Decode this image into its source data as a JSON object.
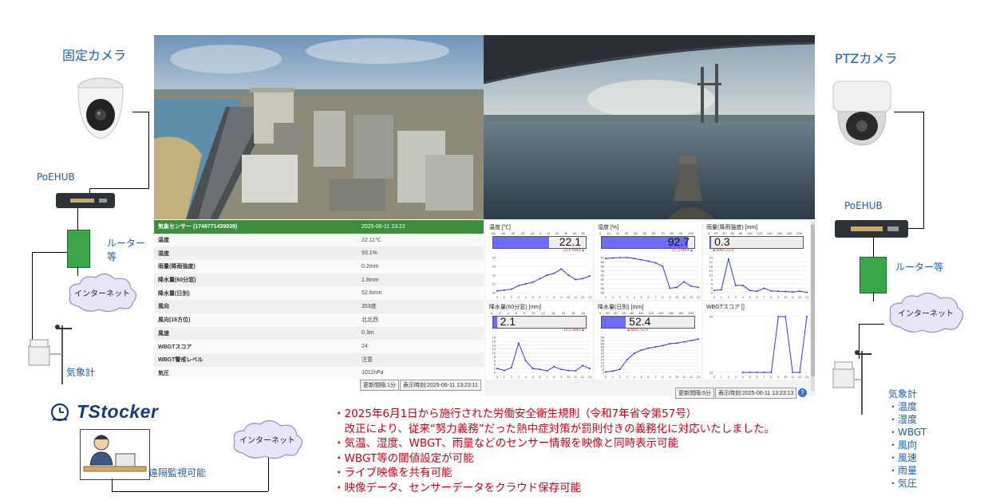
{
  "left": {
    "fixed_camera_title": "固定カメラ",
    "poe_hub_label": "PoEHUB",
    "router_label_line1": "ルーター",
    "router_label_line2": "等",
    "internet_label": "インターネット",
    "weather_meter_label": "気象計"
  },
  "right": {
    "ptz_camera_title": "PTZカメラ",
    "poe_hub_label": "PoEHUB",
    "router_label": "ルーター等",
    "internet_label": "インターネット",
    "weather_meter_label": "気象計",
    "weather_items": [
      "・温度",
      "・湿度",
      "・WBGT",
      "・風向",
      "・風速",
      "・雨量",
      "・気圧"
    ]
  },
  "bottom_left": {
    "brand": "TStocker",
    "internet_label": "インターネット",
    "remote_label": "遠隔監視可能"
  },
  "sensor_table": {
    "header_key": "気象センサー (1746771439039)",
    "header_value": "2025-06-11 13:22",
    "rows": [
      {
        "k": "温度",
        "v": "22.11℃"
      },
      {
        "k": "湿度",
        "v": "93.1%"
      },
      {
        "k": "雨量(降雨強度)",
        "v": "0.2mm"
      },
      {
        "k": "降水量(60分窓)",
        "v": "1.8mm"
      },
      {
        "k": "降水量(日別)",
        "v": "52.6mm"
      },
      {
        "k": "風向",
        "v": "353度"
      },
      {
        "k": "風向(16方位)",
        "v": "北北西"
      },
      {
        "k": "風速",
        "v": "0.3m"
      },
      {
        "k": "WBGTスコア",
        "v": "24"
      },
      {
        "k": "WBGT警戒レベル",
        "v": "注意"
      },
      {
        "k": "気圧",
        "v": "1011hPa"
      }
    ],
    "update_interval": "更新間隔:1分",
    "display_time": "表示時刻:2025-06-11 13:23:11"
  },
  "charts_footer": {
    "update_interval": "更新間隔:5分",
    "display_time": "表示時刻:2025-06-11 13:23:13",
    "help_icon": "?"
  },
  "chart_data": [
    {
      "type": "line",
      "title": "温度 [℃]",
      "gauge_value": "22.1",
      "gauge_max": "22.6 MAX▲",
      "gauge_fraction": 0.6,
      "gauge_ticks": [
        "-50",
        "-40",
        "-30",
        "-20",
        "-10",
        "0",
        "10",
        "20",
        "30",
        "40",
        "50"
      ],
      "yticks": [
        "20",
        "21",
        "22",
        "23",
        "24"
      ],
      "xticks": [
        "0",
        "1",
        "2",
        "3",
        "4",
        "5",
        "6",
        "7",
        "8",
        "9",
        "10",
        "11",
        "12",
        "13"
      ],
      "values": [
        20.2,
        20.3,
        20.4,
        20.8,
        21.0,
        21.2,
        21.6,
        22.0,
        22.2,
        22.7,
        22.0,
        21.5,
        21.6,
        21.9
      ]
    },
    {
      "type": "line",
      "title": "湿度 [%]",
      "gauge_value": "92.7",
      "gauge_max": "97.3 MAX▲",
      "gauge_fraction": 0.93,
      "gauge_ticks": [
        "0",
        "10",
        "20",
        "30",
        "40",
        "50",
        "60",
        "70",
        "80",
        "90",
        "100"
      ],
      "yticks": [
        "89",
        "90",
        "91",
        "92",
        "93",
        "94",
        "95",
        "96",
        "97"
      ],
      "xticks": [
        "0",
        "1",
        "2",
        "3",
        "4",
        "5",
        "6",
        "7",
        "8",
        "9",
        "10",
        "11",
        "12",
        "13"
      ],
      "values": [
        96.8,
        96.9,
        97.0,
        97.0,
        96.8,
        96.5,
        96.2,
        95.8,
        95.0,
        90.0,
        90.2,
        91.5,
        90.5,
        90.2
      ]
    },
    {
      "type": "line",
      "title": "雨量(降雨強度) [mm]",
      "gauge_value": "0.3",
      "gauge_max": "▲MAX 23.5",
      "gauge_fraction": 0.01,
      "gauge_ticks": [
        "0",
        "20",
        "40",
        "60",
        "80",
        "100",
        "120",
        "140",
        "160",
        "180",
        "200"
      ],
      "yticks": [
        "0",
        "3",
        "6",
        "9",
        "12",
        "15",
        "18",
        "21",
        "24"
      ],
      "xticks": [
        "0",
        "1",
        "2",
        "3",
        "4",
        "5",
        "6",
        "7",
        "8",
        "9",
        "10",
        "11",
        "12",
        "13"
      ],
      "values": [
        1.5,
        2.0,
        23.0,
        5.0,
        5.0,
        1.5,
        1.0,
        3.0,
        1.2,
        1.0,
        0.8,
        0.5,
        1.0,
        0.3
      ]
    },
    {
      "type": "line",
      "title": "降水量(60分窓) [mm]",
      "gauge_value": "2.1",
      "gauge_max": "18.5 MAX▲",
      "gauge_fraction": 0.04,
      "gauge_ticks": [
        "0",
        "2",
        "4",
        "6",
        "8",
        "10",
        "12",
        "14",
        "16",
        "18",
        "20"
      ],
      "yticks": [
        "0",
        "2",
        "4",
        "6",
        "8",
        "10",
        "12",
        "14",
        "16",
        "18"
      ],
      "xticks": [
        "0",
        "1",
        "2",
        "3",
        "4",
        "5",
        "6",
        "7",
        "8",
        "9",
        "10",
        "11",
        "12",
        "13"
      ],
      "values": [
        2.0,
        1.0,
        2.5,
        15.0,
        6.0,
        2.0,
        1.5,
        0.8,
        3.0,
        1.5,
        1.0,
        0.8,
        3.5,
        2.0
      ]
    },
    {
      "type": "line",
      "title": "降水量(日別) [mm]",
      "gauge_value": "52.4",
      "gauge_max": "▲MAX 52.4",
      "gauge_fraction": 0.26,
      "gauge_ticks": [
        "0",
        "20",
        "40",
        "60",
        "80",
        "100",
        "120",
        "140",
        "160",
        "180",
        "200"
      ],
      "yticks": [
        "0",
        "5",
        "10",
        "15",
        "20",
        "25",
        "30",
        "35",
        "40",
        "45",
        "50",
        "55"
      ],
      "xticks": [
        "0",
        "1",
        "2",
        "3",
        "4",
        "5",
        "6",
        "7",
        "8",
        "9",
        "10",
        "11",
        "12",
        "13"
      ],
      "values": [
        1,
        2,
        5,
        20,
        30,
        35,
        38,
        40,
        42,
        45,
        46,
        48,
        50,
        52.4
      ]
    },
    {
      "type": "line",
      "title": "WBGTスコア []",
      "gauge_value": "",
      "gauge_max": "",
      "yticks": [
        "23",
        "24"
      ],
      "xticks": [
        "0",
        "1",
        "2",
        "3",
        "4",
        "5",
        "6",
        "7",
        "8",
        "9",
        "10",
        "11",
        "12",
        "13"
      ],
      "values": [
        null,
        null,
        null,
        null,
        23,
        23,
        23,
        23,
        23,
        24,
        24,
        23,
        23,
        24
      ]
    }
  ],
  "notes": [
    "・2025年6月1日から施行された労働安全衛生規則（令和7年省令第57号）",
    "　改正により、従来“努力義務”だった熱中症対策が罰則付きの義務化に対応いたしました。",
    "・気温、湿度、WBGT、雨量などのセンサー情報を映像と同時表示可能",
    "・WBGT等の閾値設定が可能",
    "・ライブ映像を共有可能",
    "・映像データ、センサーデータをクラウド保存可能"
  ]
}
